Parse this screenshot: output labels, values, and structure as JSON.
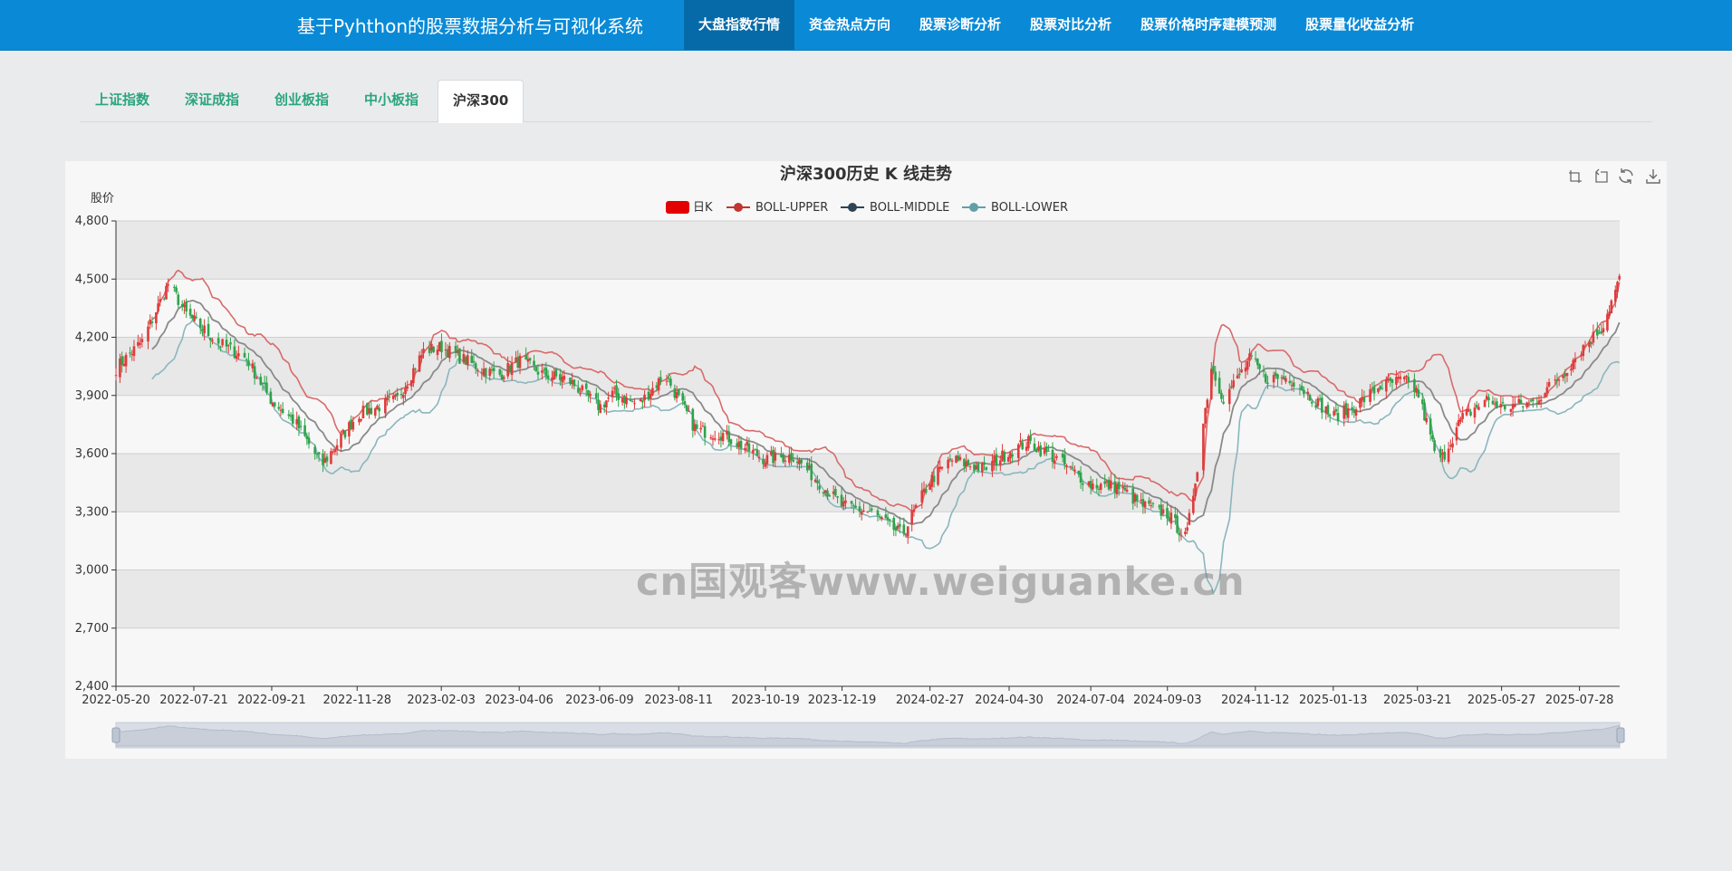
{
  "app": {
    "title": "基于Pyhthon的股票数据分析与可视化系统"
  },
  "nav": [
    {
      "label": "大盘指数行情",
      "active": true
    },
    {
      "label": "资金热点方向",
      "active": false
    },
    {
      "label": "股票诊断分析",
      "active": false
    },
    {
      "label": "股票对比分析",
      "active": false
    },
    {
      "label": "股票价格时序建模预测",
      "active": false
    },
    {
      "label": "股票量化收益分析",
      "active": false
    }
  ],
  "tabs": [
    {
      "label": "上证指数",
      "active": false
    },
    {
      "label": "深证成指",
      "active": false
    },
    {
      "label": "创业板指",
      "active": false
    },
    {
      "label": "中小板指",
      "active": false
    },
    {
      "label": "沪深300",
      "active": true
    }
  ],
  "watermark": "cn国观客www.weiguanke.cn",
  "toolbox": [
    "zoom-icon",
    "zoom-reset-icon",
    "restore-icon",
    "download-icon"
  ],
  "colors": {
    "up": "#e03b3b",
    "down": "#2fa34b",
    "boll_upper": "#d96a6a",
    "boll_middle": "#8a8a8a",
    "boll_lower": "#8ab6bd",
    "legend_rise": "#e50000",
    "legend_upper": "#c23531",
    "legend_middle": "#2f4554",
    "legend_lower": "#61a0a8"
  },
  "chart_data": {
    "type": "candlestick",
    "title": "沪深300历史 K 线走势",
    "ylabel": "股价",
    "ylim": [
      2400,
      4800
    ],
    "yticks": [
      2400,
      2700,
      3000,
      3300,
      3600,
      3900,
      4200,
      4500,
      4800
    ],
    "ytick_labels": [
      "2,400",
      "2,700",
      "3,000",
      "3,300",
      "3,600",
      "3,900",
      "4,200",
      "4,500",
      "4,800"
    ],
    "x_range": [
      "2022-05-20",
      "2025-08-29"
    ],
    "xticks": [
      "2022-05-20",
      "2022-07-21",
      "2022-09-21",
      "2022-11-28",
      "2023-02-03",
      "2023-04-06",
      "2023-06-09",
      "2023-08-11",
      "2023-10-19",
      "2023-12-19",
      "2024-02-27",
      "2024-04-30",
      "2024-07-04",
      "2024-09-03",
      "2024-11-12",
      "2025-01-13",
      "2025-03-21",
      "2025-05-27",
      "2025-07-28"
    ],
    "legend": [
      "日K",
      "BOLL-UPPER",
      "BOLL-MIDDLE",
      "BOLL-LOWER"
    ],
    "grid_bands": true,
    "dataZoom": true,
    "close_anchors": [
      [
        "2022-05-20",
        4040
      ],
      [
        "2022-06-10",
        4180
      ],
      [
        "2022-07-01",
        4480
      ],
      [
        "2022-07-15",
        4320
      ],
      [
        "2022-08-10",
        4170
      ],
      [
        "2022-09-01",
        4090
      ],
      [
        "2022-09-20",
        3880
      ],
      [
        "2022-10-10",
        3760
      ],
      [
        "2022-10-31",
        3540
      ],
      [
        "2022-11-28",
        3800
      ],
      [
        "2022-12-30",
        3880
      ],
      [
        "2023-01-20",
        4130
      ],
      [
        "2023-02-03",
        4150
      ],
      [
        "2023-02-28",
        4060
      ],
      [
        "2023-03-20",
        4000
      ],
      [
        "2023-04-06",
        4080
      ],
      [
        "2023-04-25",
        4010
      ],
      [
        "2023-05-15",
        3980
      ],
      [
        "2023-06-09",
        3840
      ],
      [
        "2023-06-20",
        3910
      ],
      [
        "2023-07-10",
        3850
      ],
      [
        "2023-07-31",
        4010
      ],
      [
        "2023-08-11",
        3880
      ],
      [
        "2023-08-25",
        3720
      ],
      [
        "2023-09-15",
        3700
      ],
      [
        "2023-10-19",
        3570
      ],
      [
        "2023-11-10",
        3590
      ],
      [
        "2023-12-19",
        3330
      ],
      [
        "2024-01-10",
        3300
      ],
      [
        "2024-02-05",
        3180
      ],
      [
        "2024-02-27",
        3460
      ],
      [
        "2024-03-15",
        3570
      ],
      [
        "2024-04-10",
        3520
      ],
      [
        "2024-04-30",
        3610
      ],
      [
        "2024-05-15",
        3660
      ],
      [
        "2024-06-07",
        3570
      ],
      [
        "2024-07-04",
        3440
      ],
      [
        "2024-07-25",
        3430
      ],
      [
        "2024-08-15",
        3330
      ],
      [
        "2024-09-03",
        3290
      ],
      [
        "2024-09-18",
        3160
      ],
      [
        "2024-09-26",
        3500
      ],
      [
        "2024-10-08",
        4050
      ],
      [
        "2024-10-18",
        3880
      ],
      [
        "2024-11-08",
        4090
      ],
      [
        "2024-11-20",
        3990
      ],
      [
        "2024-12-10",
        3990
      ],
      [
        "2025-01-13",
        3790
      ],
      [
        "2025-01-27",
        3830
      ],
      [
        "2025-02-20",
        3950
      ],
      [
        "2025-03-10",
        3980
      ],
      [
        "2025-03-21",
        3920
      ],
      [
        "2025-04-07",
        3540
      ],
      [
        "2025-04-25",
        3780
      ],
      [
        "2025-05-15",
        3880
      ],
      [
        "2025-05-27",
        3840
      ],
      [
        "2025-06-20",
        3860
      ],
      [
        "2025-07-15",
        4010
      ],
      [
        "2025-07-28",
        4130
      ],
      [
        "2025-08-15",
        4250
      ],
      [
        "2025-08-29",
        4500
      ]
    ]
  }
}
